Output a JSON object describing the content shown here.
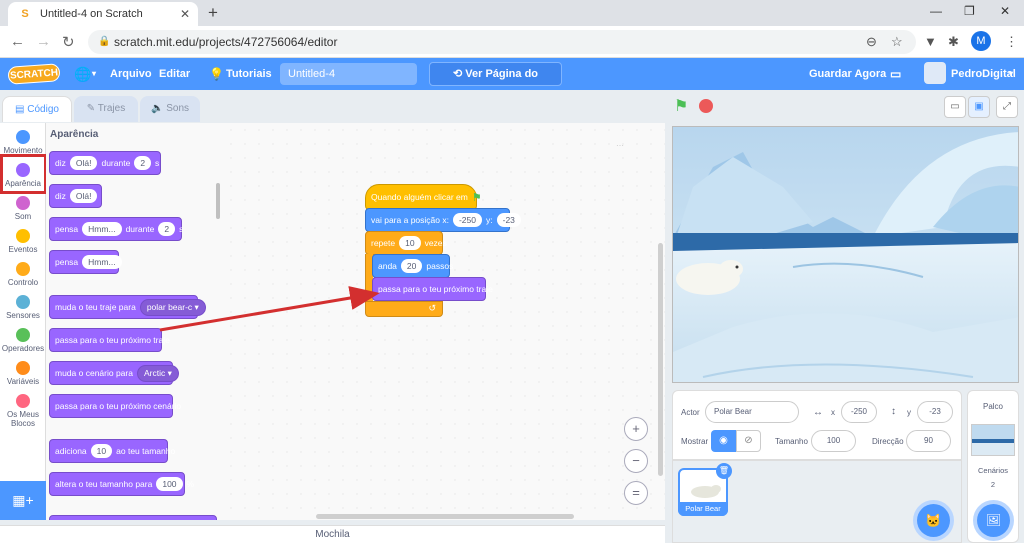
{
  "browser": {
    "tab_title": "Untitled-4 on Scratch",
    "url": "scratch.mit.edu/projects/472756064/editor",
    "profile_initial": "M"
  },
  "menu": {
    "logo": "SCRATCH",
    "file": "Arquivo",
    "edit": "Editar",
    "tutorials": "Tutoriais",
    "project_title": "Untitled-4",
    "see_project": "Ver Página do Projecto",
    "save_now": "Guardar Agora",
    "username": "PedroDigital"
  },
  "tabs": {
    "code": "Código",
    "costumes": "Trajes",
    "sounds": "Sons"
  },
  "categories": [
    {
      "label": "Movimento",
      "color": "#4c97ff"
    },
    {
      "label": "Aparência",
      "color": "#9966ff"
    },
    {
      "label": "Som",
      "color": "#cf63cf"
    },
    {
      "label": "Eventos",
      "color": "#ffbf00"
    },
    {
      "label": "Controlo",
      "color": "#ffab19"
    },
    {
      "label": "Sensores",
      "color": "#5cb1d6"
    },
    {
      "label": "Operadores",
      "color": "#59c059"
    },
    {
      "label": "Variáveis",
      "color": "#ff8c1a"
    },
    {
      "label": "Os Meus Blocos",
      "color": "#ff6680"
    }
  ],
  "palette": {
    "heading": "Aparência",
    "say_for": {
      "say": "diz",
      "msg": "Olá!",
      "for": "durante",
      "secs": "2",
      "s": "s"
    },
    "say": {
      "say": "diz",
      "msg": "Olá!"
    },
    "think_for": {
      "think": "pensa",
      "msg": "Hmm...",
      "for": "durante",
      "secs": "2",
      "s": "s"
    },
    "think": {
      "think": "pensa",
      "msg": "Hmm..."
    },
    "switch_costume": {
      "label": "muda o teu traje para",
      "value": "polar bear-c"
    },
    "next_costume": "passa para o teu próximo traje",
    "switch_backdrop": {
      "label": "muda o cenário para",
      "value": "Arctic"
    },
    "next_backdrop": "passa para o teu próximo cenário",
    "change_size": {
      "add": "adiciona",
      "value": "10",
      "rest": "ao teu tamanho"
    },
    "set_size": {
      "label": "altera o teu tamanho para",
      "value": "100",
      "pct": "%"
    }
  },
  "script": {
    "hat": "Quando alguém clicar em",
    "goto": {
      "label": "vai para a posição x:",
      "x": "-250",
      "ylabel": "y:",
      "y": "-23"
    },
    "repeat": {
      "label": "repete",
      "count": "10",
      "times": "vezes"
    },
    "move": {
      "label": "anda",
      "steps": "20",
      "unit": "passos"
    },
    "next_costume": "passa para o teu próximo traje"
  },
  "workspace": {
    "mochila": "Mochila",
    "zoom_in": "+",
    "zoom_out": "−",
    "zoom_reset": "="
  },
  "sprite_info": {
    "actor_label": "Actor",
    "name": "Polar Bear",
    "x_label": "x",
    "x": "-250",
    "y_label": "y",
    "y": "-23",
    "show_label": "Mostrar",
    "size_label": "Tamanho",
    "size": "100",
    "direction_label": "Direcção",
    "direction": "90"
  },
  "sprite_list": {
    "selected": "Polar Bear"
  },
  "stage_panel": {
    "title": "Palco",
    "backdrops_label": "Cenários",
    "backdrops_count": "2"
  },
  "colors": {
    "menu_blue": "#4c97ff",
    "looks": "#9966ff",
    "events": "#ffbf00",
    "motion": "#4c97ff",
    "control": "#ffab19",
    "highlight_red": "#d32f2f"
  }
}
